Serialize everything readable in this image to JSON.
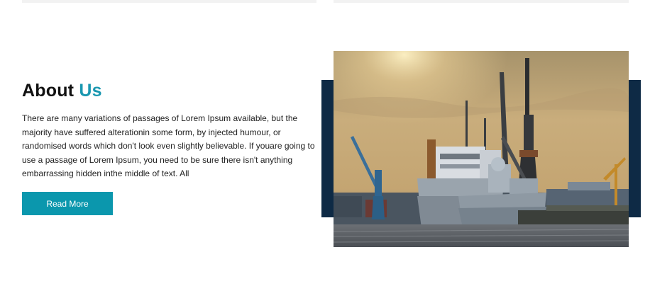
{
  "about": {
    "title_main": "About",
    "title_accent": "Us",
    "paragraph": "There are many variations of passages of Lorem Ipsum available, but the majority have suffered alterationin some form, by injected humour, or randomised words which don't look even slightly believable. If youare going to use a passage of Lorem Ipsum, you need to be sure there isn't anything embarrassing hidden inthe middle of text. All",
    "button_label": "Read More"
  },
  "image": {
    "subject": "harbor-ships-cranes-photo"
  },
  "colors": {
    "accent": "#1a97b0",
    "button": "#0b97ad",
    "navy": "#0e2a45"
  }
}
